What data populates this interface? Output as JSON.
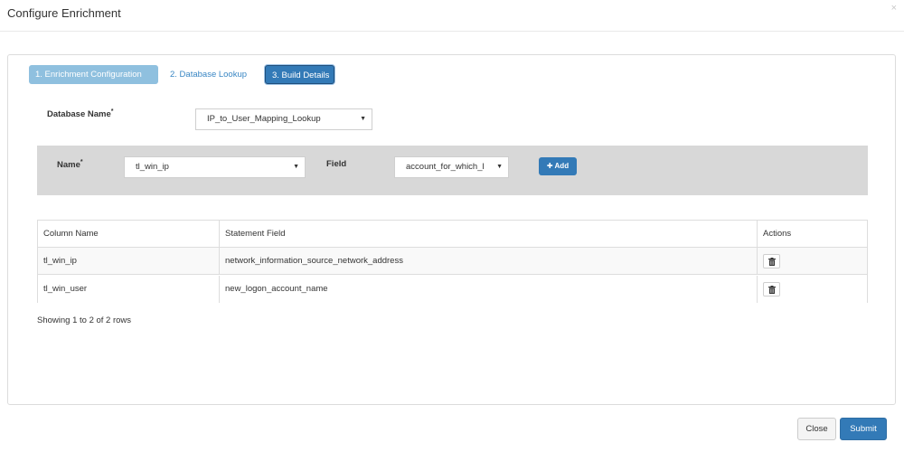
{
  "modal": {
    "title": "Configure Enrichment",
    "close_symbol": "×"
  },
  "wizard": {
    "steps": [
      {
        "label": "1. Enrichment Configuration",
        "state": "completed"
      },
      {
        "label": "2. Database Lookup",
        "state": "link"
      },
      {
        "label": "3. Build Details",
        "state": "active"
      }
    ]
  },
  "database": {
    "label": "Database Name",
    "required_mark": "*",
    "selected": "IP_to_User_Mapping_Lookup"
  },
  "mapping_form": {
    "name_label": "Name",
    "name_required_mark": "*",
    "name_selected": "tl_win_ip",
    "field_label": "Field",
    "field_selected": "account_for_which_l",
    "add_label": "Add",
    "add_icon": "plus-icon"
  },
  "table": {
    "headers": [
      "Column Name",
      "Statement Field",
      "Actions"
    ],
    "rows": [
      {
        "column_name": "tl_win_ip",
        "statement_field": "network_information_source_network_address",
        "action_icon": "trash-icon"
      },
      {
        "column_name": "tl_win_user",
        "statement_field": "new_logon_account_name",
        "action_icon": "trash-icon"
      }
    ],
    "pagination_info": "Showing 1 to 2 of 2 rows"
  },
  "footer": {
    "close_label": "Close",
    "submit_label": "Submit"
  },
  "colors": {
    "primary": "#337ab7",
    "step_completed": "#8fc0df",
    "filter_bar_bg": "#d8d8d8",
    "link": "#3a87c4"
  }
}
